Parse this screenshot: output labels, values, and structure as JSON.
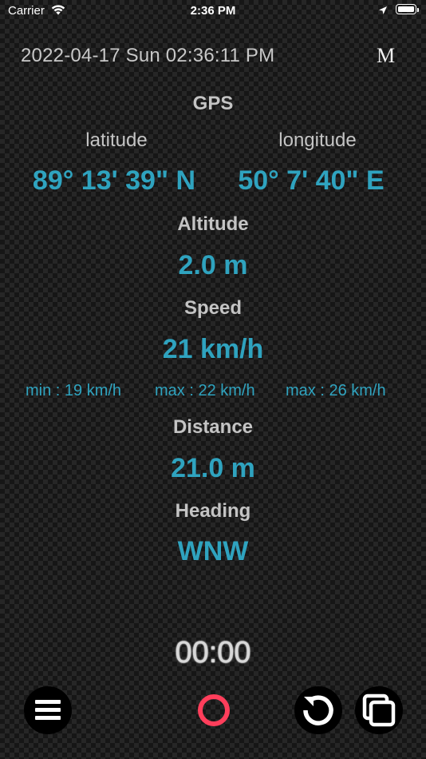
{
  "status_bar": {
    "carrier": "Carrier",
    "time": "2:36 PM",
    "icons": [
      "wifi-icon",
      "location-arrow-icon",
      "battery-icon"
    ]
  },
  "header": {
    "datetime": "2022-04-17 Sun 02:36:11 PM",
    "mode_button": "M"
  },
  "gps": {
    "title": "GPS",
    "latitude_label": "latitude",
    "longitude_label": "longitude",
    "latitude_value": "89° 13' 39\" N",
    "longitude_value": "50° 7' 40\" E"
  },
  "altitude": {
    "label": "Altitude",
    "value": "2.0 m"
  },
  "speed": {
    "label": "Speed",
    "value": "21 km/h",
    "min": "min : 19 km/h",
    "max1": "max : 22 km/h",
    "max2": "max : 26 km/h"
  },
  "distance": {
    "label": "Distance",
    "value": "21.0 m"
  },
  "heading": {
    "label": "Heading",
    "value": "WNW"
  },
  "timer": "00:00",
  "toolbar": {
    "icons": [
      "menu-icon",
      "record-icon",
      "reset-icon",
      "pages-icon"
    ]
  },
  "colors": {
    "accent": "#2fa3bf",
    "record": "#ff3e5b",
    "label": "#c4c4c4"
  }
}
